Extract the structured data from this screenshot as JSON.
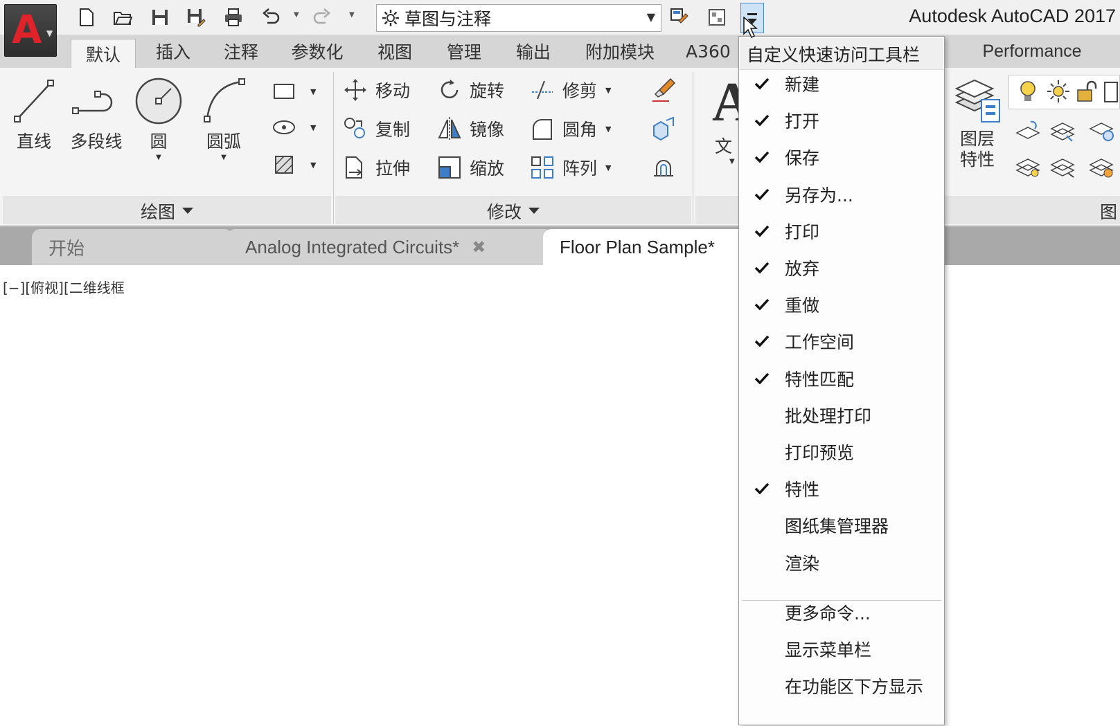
{
  "app": {
    "title": "Autodesk AutoCAD 2017"
  },
  "quick_access": {
    "workspace": "草图与注释"
  },
  "ribbon_tabs": [
    "默认",
    "插入",
    "注释",
    "参数化",
    "视图",
    "管理",
    "输出",
    "附加模块",
    "A360",
    "Performance"
  ],
  "draw_panel": {
    "title": "绘图",
    "line": "直线",
    "polyline": "多段线",
    "circle": "圆",
    "arc": "圆弧"
  },
  "modify_panel": {
    "title": "修改",
    "move": "移动",
    "rotate": "旋转",
    "trim": "修剪",
    "copy": "复制",
    "mirror": "镜像",
    "fillet": "圆角",
    "stretch": "拉伸",
    "scale": "缩放",
    "array": "阵列"
  },
  "annotation_panel": {
    "text_partial": "文"
  },
  "layers_panel": {
    "layer_properties_line1": "图层",
    "layer_properties_line2": "特性",
    "title_partial": "图"
  },
  "file_tabs": {
    "start": "开始",
    "analog": "Analog Integrated Circuits*",
    "floor": "Floor Plan Sample*"
  },
  "viewport": {
    "label": "[−][俯视][二维线框"
  },
  "menu": {
    "title": "自定义快速访问工具栏",
    "items": [
      {
        "label": "新建",
        "checked": true
      },
      {
        "label": "打开",
        "checked": true
      },
      {
        "label": "保存",
        "checked": true
      },
      {
        "label": "另存为...",
        "checked": true
      },
      {
        "label": "打印",
        "checked": true
      },
      {
        "label": "放弃",
        "checked": true
      },
      {
        "label": "重做",
        "checked": true
      },
      {
        "label": "工作空间",
        "checked": true
      },
      {
        "label": "特性匹配",
        "checked": true
      },
      {
        "label": "批处理打印",
        "checked": false
      },
      {
        "label": "打印预览",
        "checked": false
      },
      {
        "label": "特性",
        "checked": true
      },
      {
        "label": "图纸集管理器",
        "checked": false
      },
      {
        "label": "渲染",
        "checked": false
      }
    ],
    "extra_items": [
      "更多命令...",
      "显示菜单栏",
      "在功能区下方显示"
    ]
  },
  "colors": {
    "accent": "#4a8ed8",
    "logo_red": "#e0222a"
  }
}
